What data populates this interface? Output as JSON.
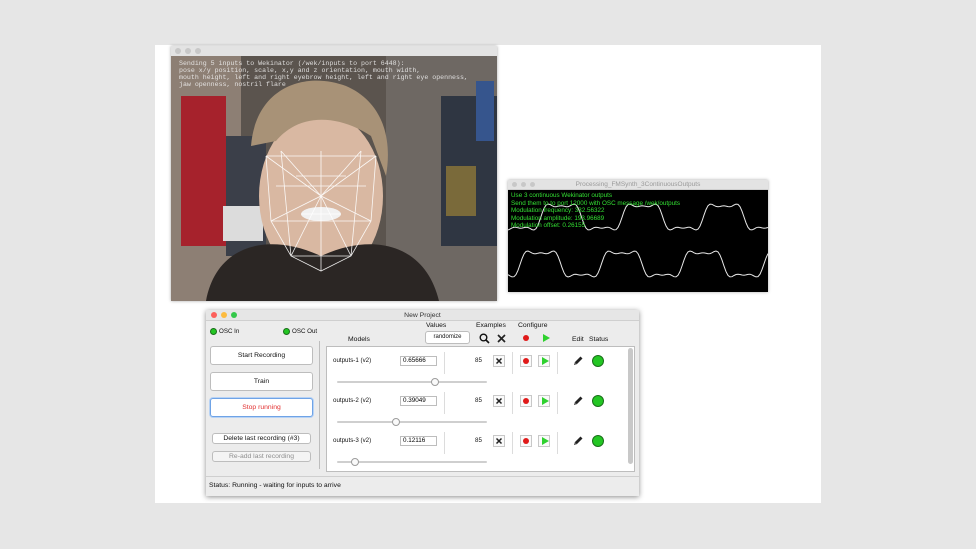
{
  "webcam": {
    "overlay_lines": [
      "Sending 5 inputs to Wekinator (/wek/inputs to port 6448):",
      "pose x/y position, scale, x,y and z orientation, mouth width,",
      "mouth height, left and right eyebrow height, left and right eye openness,",
      "jaw openness, nostril flare"
    ]
  },
  "synth": {
    "title": "Processing_FMSynth_3ContinuousOutputs",
    "lines": [
      "Use 3 continuous Wekinator outputs",
      "Send them to to port 12000 with OSC message /wek/outputs",
      "Modulation frequency: 332.56322",
      "Modulation amplitude: 193.96689",
      "Modulation offset: 0.26155"
    ],
    "wave_color": "#e8e8e8",
    "text_color": "#33e033"
  },
  "wekinator": {
    "title": "New Project",
    "osc_in_label": "OSC In",
    "osc_out_label": "OSC Out",
    "buttons": {
      "start_recording": "Start Recording",
      "train": "Train",
      "stop_running": "Stop running",
      "delete_last": "Delete last recording (#3)",
      "readd_last": "Re-add last recording"
    },
    "headers": {
      "models": "Models",
      "values": "Values",
      "examples": "Examples",
      "configure": "Configure",
      "edit": "Edit",
      "status": "Status"
    },
    "randomize_label": "randomize",
    "models": [
      {
        "name": "outputs-1 (v2)",
        "value": "0.65666",
        "examples": "85",
        "slider": 0.65666
      },
      {
        "name": "outputs-2 (v2)",
        "value": "0.39049",
        "examples": "85",
        "slider": 0.39049
      },
      {
        "name": "outputs-3 (v2)",
        "value": "0.12116",
        "examples": "85",
        "slider": 0.12116
      }
    ],
    "status_label": "Status:",
    "status_text": "Running - waiting for inputs to arrive",
    "colors": {
      "led_on": "#23c623",
      "record": "#e01a1a",
      "run": "#2fd12f",
      "stop_text": "#e23030"
    }
  }
}
